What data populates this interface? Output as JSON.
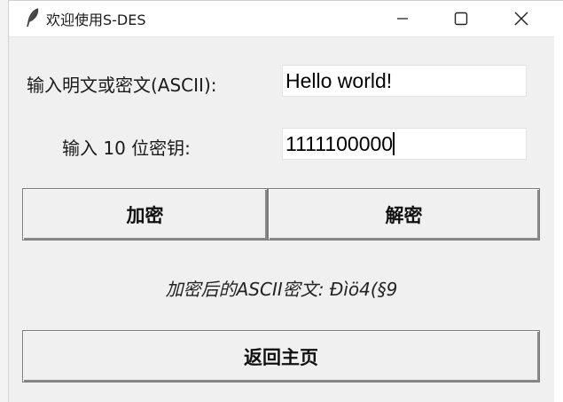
{
  "window": {
    "title": "欢迎使用S-DES",
    "icon": "feather-icon",
    "controls": [
      "minimize-icon",
      "maximize-icon",
      "close-icon"
    ]
  },
  "form": {
    "text_label": "输入明文或密文(ASCII):",
    "text_value": "Hello world!",
    "key_label": "输入 10 位密钥:",
    "key_value": "1111100000"
  },
  "buttons": {
    "encrypt": "加密",
    "decrypt": "解密",
    "home": "返回主页"
  },
  "result": {
    "text": "加密后的ASCII密文: Ðìö4(§9"
  }
}
